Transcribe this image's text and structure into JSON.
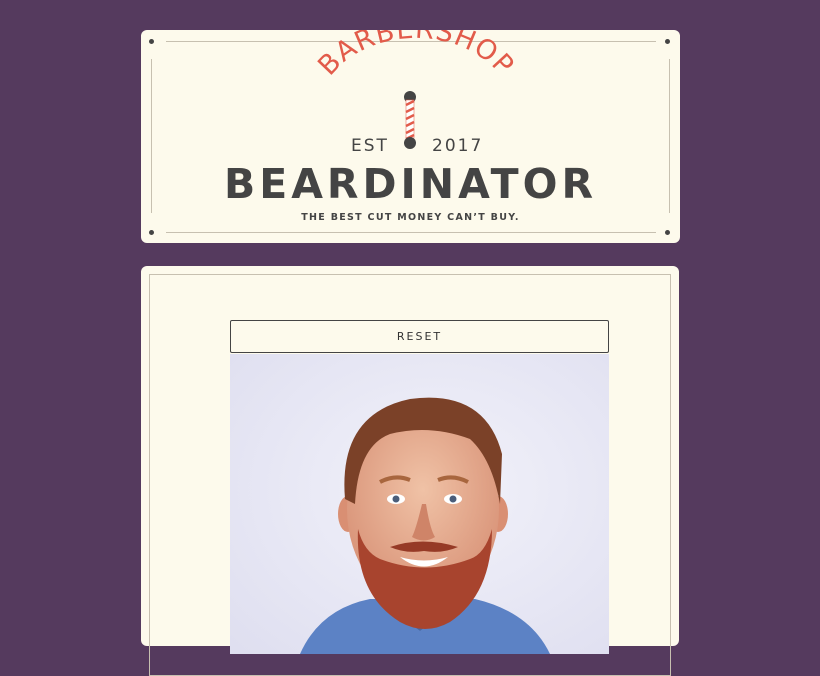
{
  "header": {
    "arc_text": "BARBERSHOP",
    "est": "EST",
    "year": "2017",
    "brand": "BEARDINATOR",
    "tagline": "THE BEST CUT MONEY CAN’T BUY."
  },
  "main": {
    "reset_label": "RESET"
  },
  "colors": {
    "background": "#553a5e",
    "card": "#fdfaec",
    "accent": "#e25b4a",
    "text": "#444444"
  },
  "icons": [
    "barber-pole-icon"
  ]
}
